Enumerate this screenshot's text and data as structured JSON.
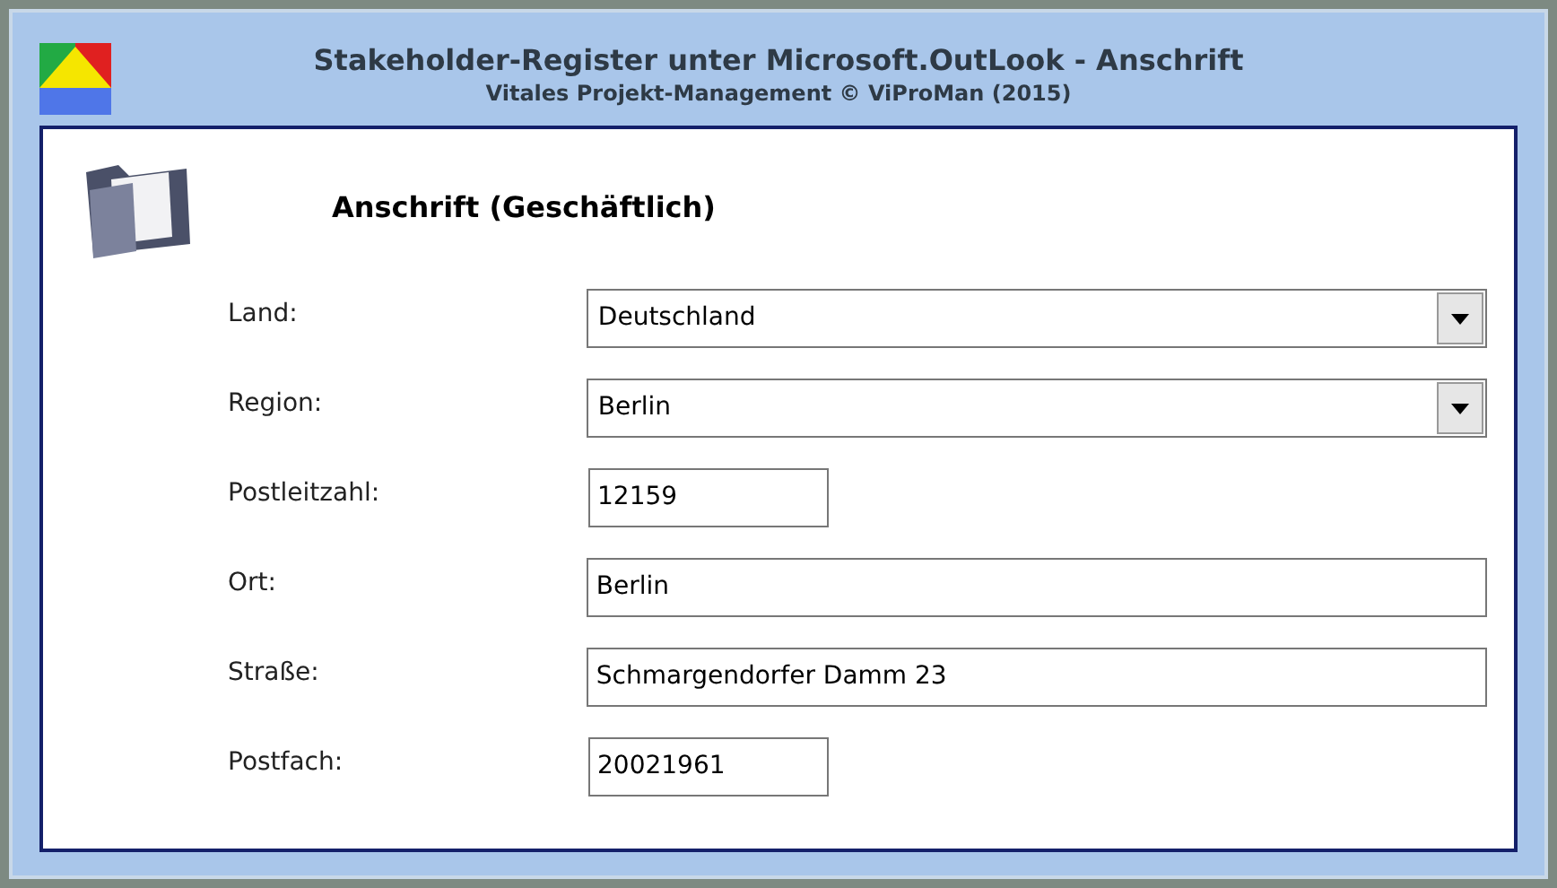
{
  "window": {
    "title": "Stakeholder-Register unter Microsoft.OutLook - Anschrift",
    "subtitle": "Vitales Projekt-Management © ViProMan  (2015)"
  },
  "section": {
    "title": "Anschrift (Geschäftlich)"
  },
  "fields": [
    {
      "label": "Land:",
      "value": "Deutschland",
      "kind": "dropdown",
      "wide": true
    },
    {
      "label": "Region:",
      "value": "Berlin",
      "kind": "dropdown",
      "wide": true
    },
    {
      "label": "Postleitzahl:",
      "value": "12159",
      "kind": "text",
      "wide": false
    },
    {
      "label": "Ort:",
      "value": "Berlin",
      "kind": "text",
      "wide": true
    },
    {
      "label": "Straße:",
      "value": "Schmargendorfer Damm 23",
      "kind": "text",
      "wide": true
    },
    {
      "label": "Postfach:",
      "value": "20021961",
      "kind": "text",
      "wide": false
    }
  ]
}
